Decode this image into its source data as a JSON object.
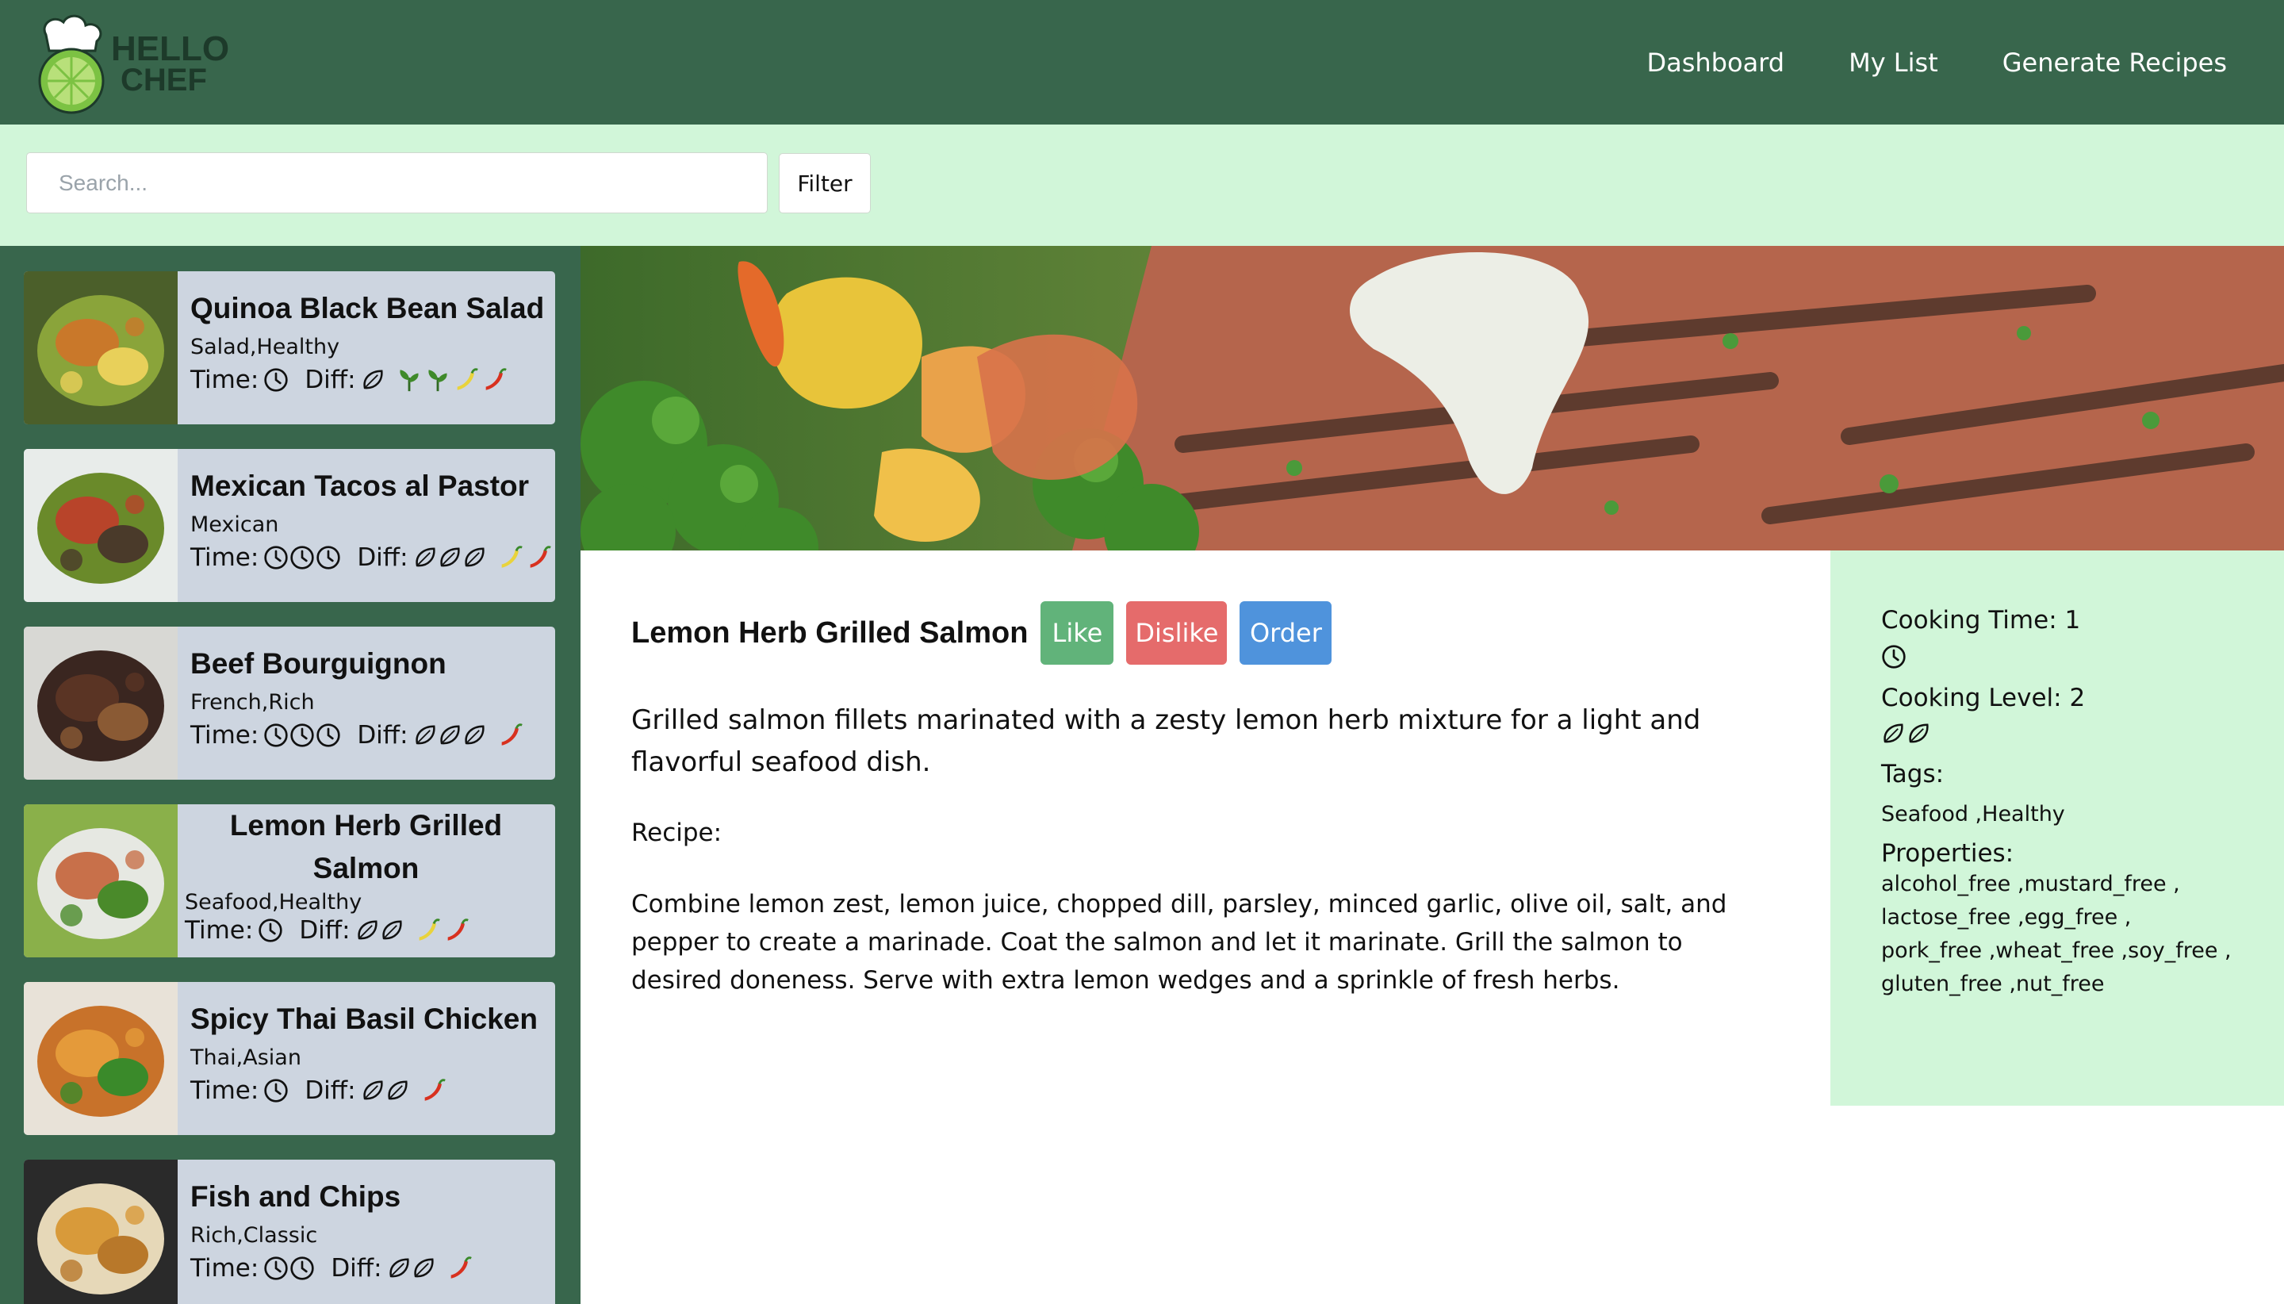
{
  "nav": {
    "logo_alt": "HELLO CHEF",
    "logo_line1": "HELLO",
    "logo_line2": "CHEF",
    "links": [
      "Dashboard",
      "My List",
      "Generate Recipes"
    ]
  },
  "search": {
    "placeholder": "Search...",
    "filter_label": "Filter"
  },
  "labels": {
    "time": "Time:",
    "diff": "Diff:"
  },
  "recipes": [
    {
      "title": "Quinoa Black Bean Salad",
      "tags": "Salad,Healthy",
      "time": 1,
      "difficulty": 1,
      "props": [
        "leaf",
        "leaf",
        "yellow-pepper",
        "chili"
      ]
    },
    {
      "title": "Mexican Tacos al Pastor",
      "tags": "Mexican",
      "time": 3,
      "difficulty": 3,
      "props": [
        "yellow-pepper",
        "chili"
      ]
    },
    {
      "title": "Beef Bourguignon",
      "tags": "French,Rich",
      "time": 3,
      "difficulty": 3,
      "props": [
        "chili"
      ]
    },
    {
      "title": "Lemon Herb Grilled Salmon",
      "tags": "Seafood,Healthy",
      "time": 1,
      "difficulty": 2,
      "props": [
        "yellow-pepper",
        "chili"
      ]
    },
    {
      "title": "Spicy Thai Basil Chicken",
      "tags": "Thai,Asian",
      "time": 1,
      "difficulty": 2,
      "props": [
        "chili"
      ]
    },
    {
      "title": "Fish and Chips",
      "tags": "Rich,Classic",
      "time": 2,
      "difficulty": 2,
      "props": [
        "chili"
      ]
    }
  ],
  "detail": {
    "title": "Lemon Herb Grilled Salmon",
    "like_label": "Like",
    "dislike_label": "Dislike",
    "order_label": "Order",
    "description": "Grilled salmon fillets marinated with a zesty lemon herb mixture for a light and flavorful seafood dish.",
    "recipe_label": "Recipe:",
    "recipe_text": "Combine lemon zest, lemon juice, chopped dill, parsley, minced garlic, olive oil, salt, and pepper to create a marinade. Coat the salmon and let it marinate. Grill the salmon to desired doneness. Serve with extra lemon wedges and a sprinkle of fresh herbs."
  },
  "info": {
    "cooking_time_label": "Cooking Time: 1",
    "cooking_time": 1,
    "cooking_level_label": "Cooking Level: 2",
    "cooking_level": 2,
    "tags_label": "Tags:",
    "tags_value": "Seafood ,Healthy",
    "properties_label": "Properties:",
    "properties_lines": [
      "alcohol_free ,mustard_free ,",
      "lactose_free ,egg_free ,",
      "pork_free ,wheat_free ,soy_free ,",
      "gluten_free ,nut_free"
    ]
  },
  "colors": {
    "navbar": "#38664c",
    "mint": "#d1f6d9",
    "card": "#cdd5e0",
    "like": "#61b37a",
    "dislike": "#e56b6b",
    "order": "#4f93dc"
  }
}
